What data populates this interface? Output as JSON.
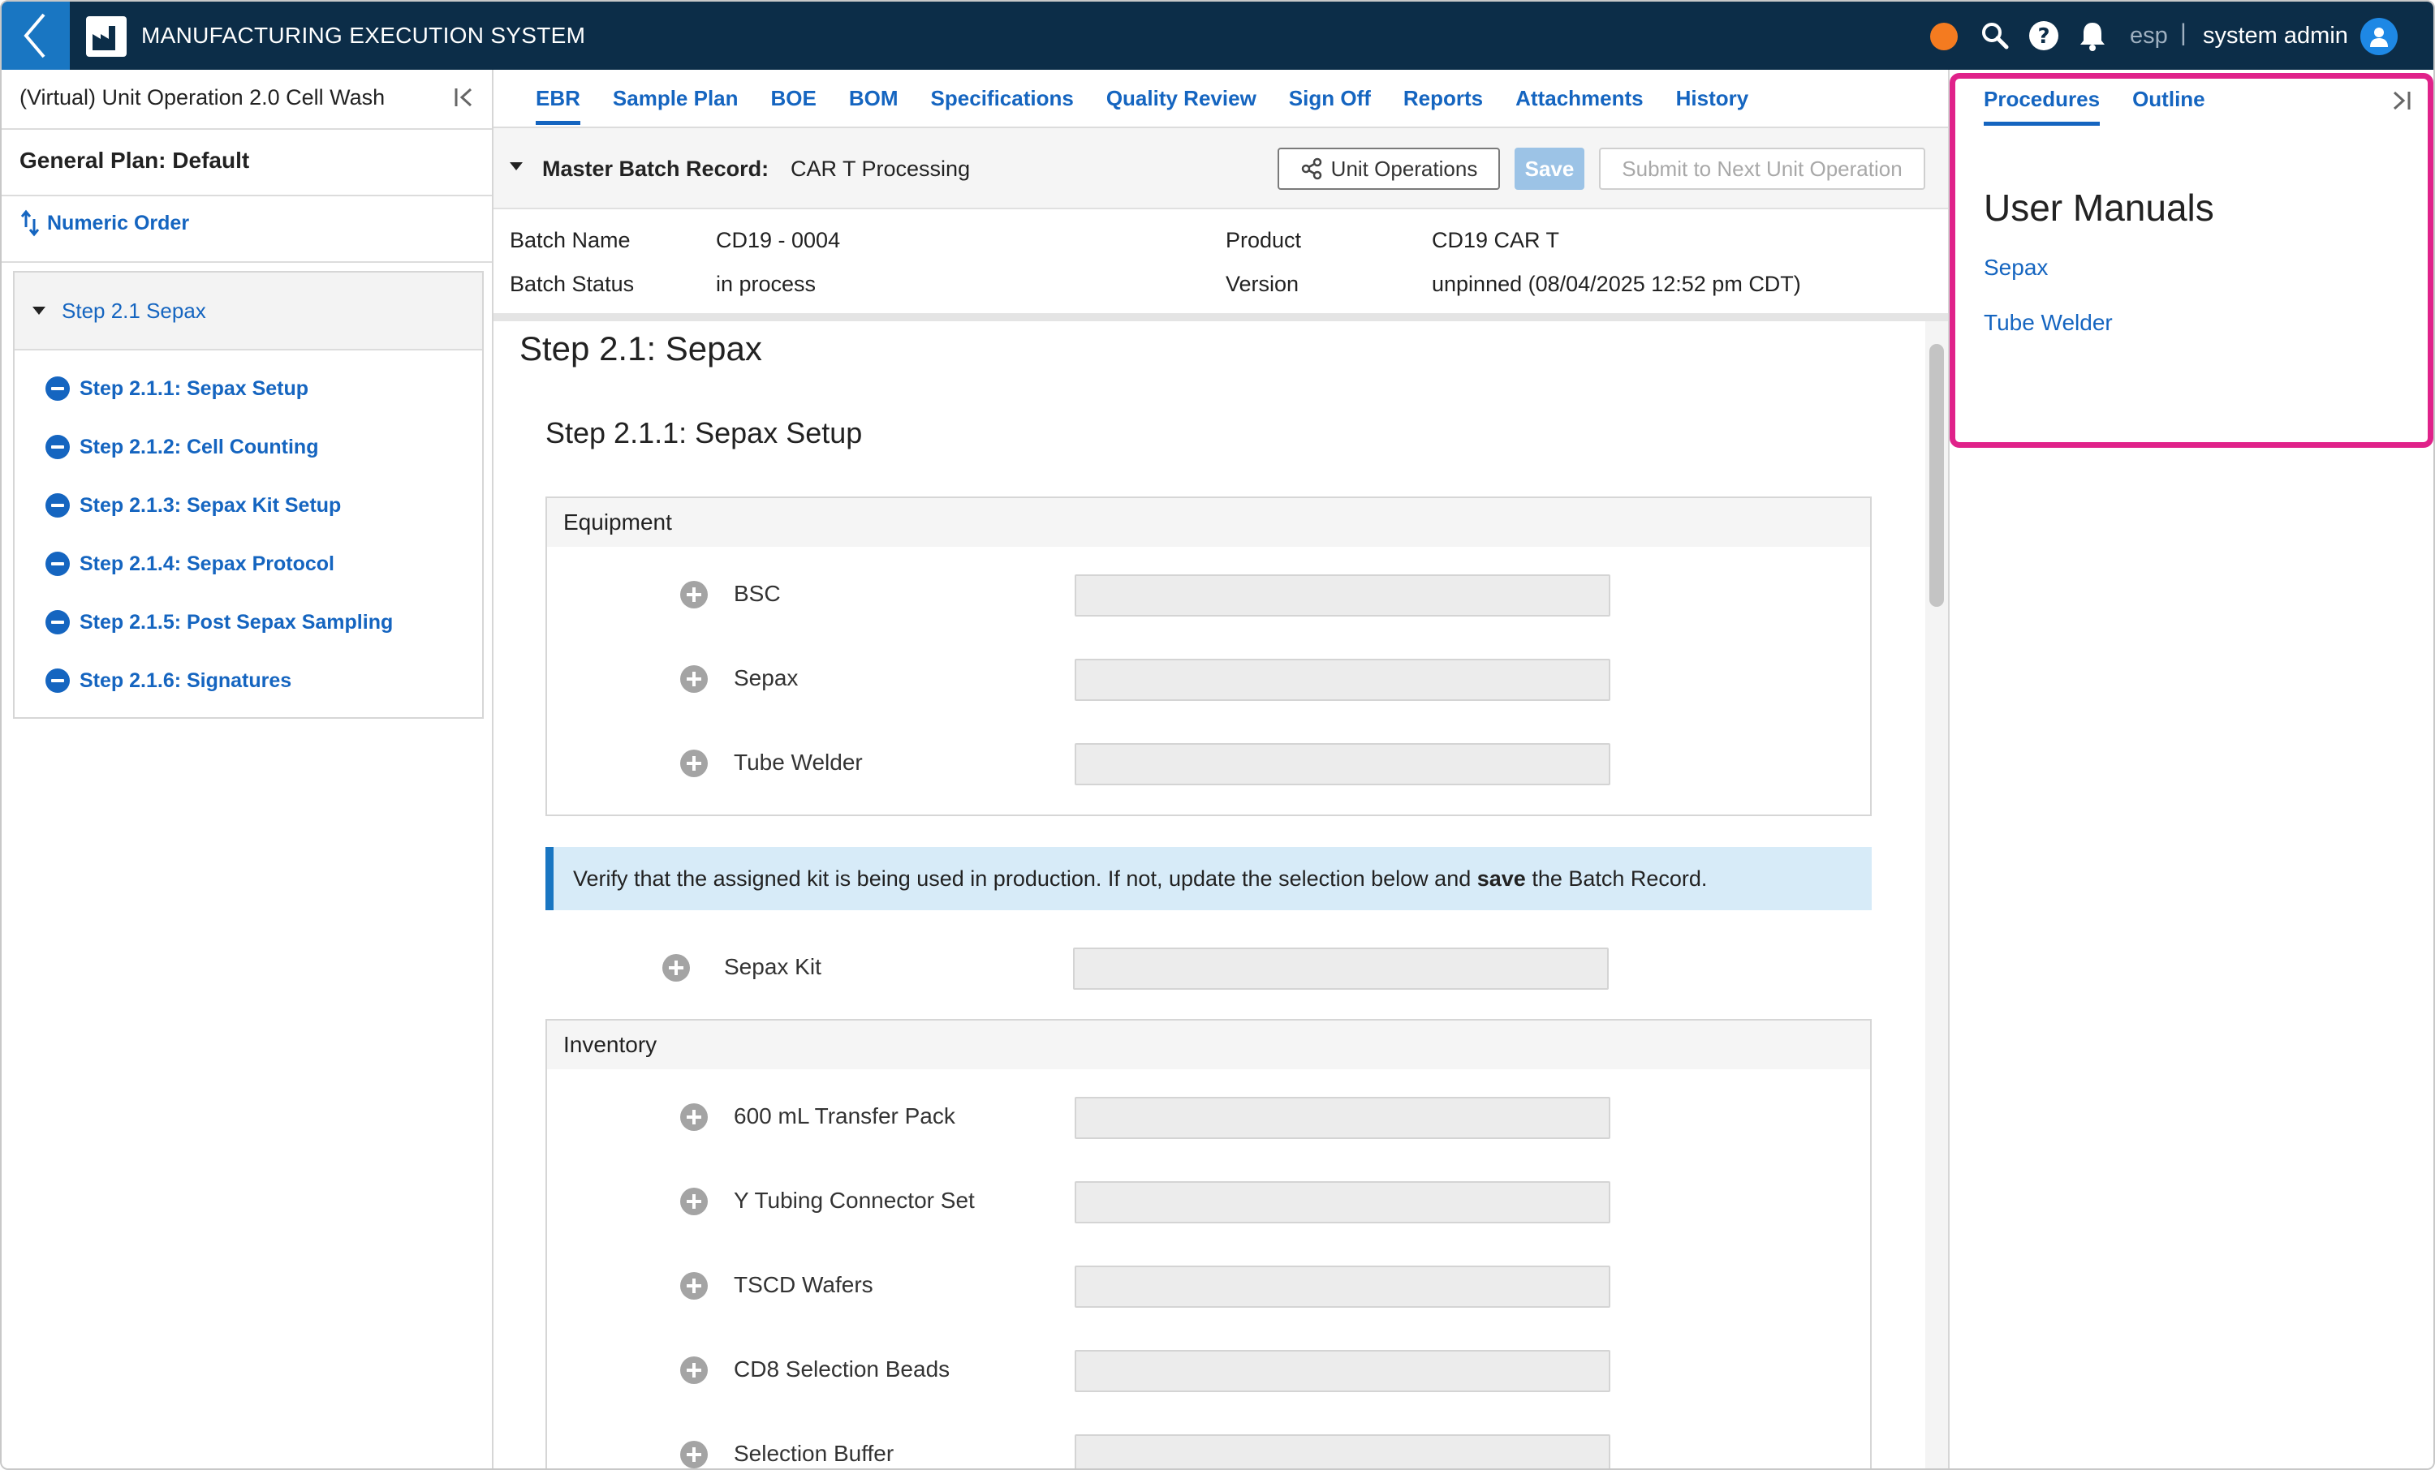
{
  "app": {
    "title": "MANUFACTURING EXECUTION SYSTEM",
    "language": "esp",
    "language_sep": "|",
    "user": "system admin"
  },
  "left_panel": {
    "unit_operation": "(Virtual) Unit Operation 2.0 Cell Wash",
    "general_plan": "General Plan: Default",
    "sort_label": "Numeric Order",
    "step_group": "Step 2.1 Sepax",
    "substeps": [
      "Step 2.1.1: Sepax Setup",
      "Step 2.1.2: Cell Counting",
      "Step 2.1.3: Sepax Kit Setup",
      "Step 2.1.4: Sepax Protocol",
      "Step 2.1.5: Post Sepax Sampling",
      "Step 2.1.6: Signatures"
    ]
  },
  "tabs": [
    "EBR",
    "Sample Plan",
    "BOE",
    "BOM",
    "Specifications",
    "Quality Review",
    "Sign Off",
    "Reports",
    "Attachments",
    "History"
  ],
  "active_tab": "EBR",
  "master_batch_record": {
    "label": "Master Batch Record:",
    "value": "CAR T Processing",
    "unit_operations_button": "Unit Operations",
    "save_button": "Save",
    "submit_button": "Submit to Next Unit Operation"
  },
  "batch": {
    "name_label": "Batch Name",
    "name": "CD19 - 0004",
    "status_label": "Batch Status",
    "status": "in process",
    "product_label": "Product",
    "product": "CD19 CAR T",
    "version_label": "Version",
    "version": "unpinned (08/04/2025 12:52 pm CDT)"
  },
  "content": {
    "step_title": "Step 2.1: Sepax",
    "substep_title": "Step 2.1.1: Sepax Setup",
    "equipment": {
      "header": "Equipment",
      "items": [
        "BSC",
        "Sepax",
        "Tube Welder"
      ]
    },
    "notice": {
      "before": "Verify that the assigned kit is being used in production. If not, update the selection below and ",
      "bold": "save",
      "after": " the Batch Record."
    },
    "kit_label": "Sepax Kit",
    "inventory": {
      "header": "Inventory",
      "items": [
        "600 mL Transfer Pack",
        "Y Tubing Connector Set",
        "TSCD Wafers",
        "CD8 Selection Beads",
        "Selection Buffer"
      ]
    }
  },
  "right_panel": {
    "tabs": [
      "Procedures",
      "Outline"
    ],
    "active_tab": "Procedures",
    "title": "User Manuals",
    "links": [
      "Sepax",
      "Tube Welder"
    ]
  },
  "colors": {
    "topbar": "#0c2d48",
    "accent": "#1565c0",
    "status_dot": "#f47b20",
    "highlight": "#e0228a"
  }
}
